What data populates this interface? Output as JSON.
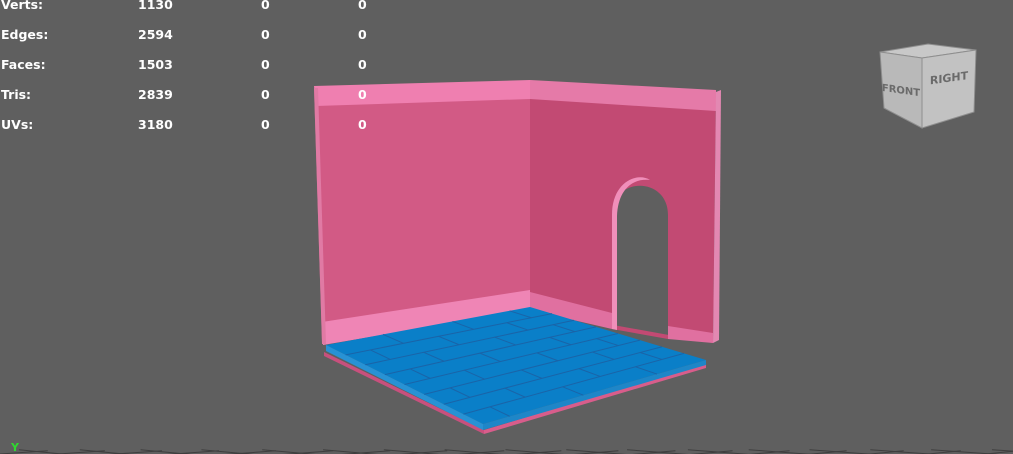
{
  "viewport": {
    "background_color": "#5f5f5f",
    "grid_color": "#3e3e3e"
  },
  "hud": {
    "text_color": "#ffffff",
    "rows": [
      {
        "label": "Verts:",
        "values": [
          "1130",
          "0",
          "0"
        ]
      },
      {
        "label": "Edges:",
        "values": [
          "2594",
          "0",
          "0"
        ]
      },
      {
        "label": "Faces:",
        "values": [
          "1503",
          "0",
          "0"
        ]
      },
      {
        "label": "Tris:",
        "values": [
          "2839",
          "0",
          "0"
        ]
      },
      {
        "label": "UVs:",
        "values": [
          "3180",
          "0",
          "0"
        ]
      }
    ]
  },
  "viewcube": {
    "front_label": "FRONT",
    "right_label": "RIGHT"
  },
  "model": {
    "wall_color": "#d25a85",
    "wall_right_color": "#c24a73",
    "trim_color": "#ef7fb0",
    "floor_color": "#0a7fc8",
    "floor_plank_line_color": "#1a64a8"
  },
  "axis_indicator": {
    "label": "Y",
    "color": "#30d830"
  }
}
